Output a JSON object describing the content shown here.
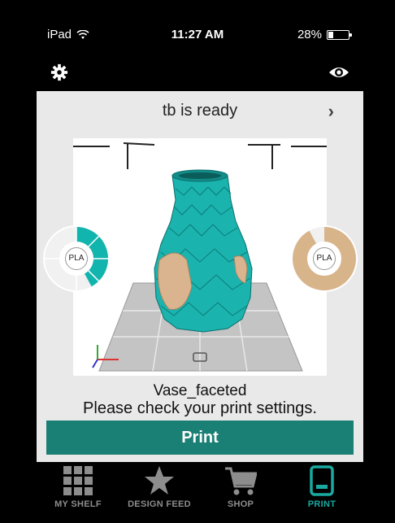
{
  "status_bar": {
    "device": "iPad",
    "time": "11:27 AM",
    "battery_text": "28%",
    "battery_level": 0.28
  },
  "toolbar": {
    "settings_icon": "gear-icon",
    "preview_icon": "eye-icon"
  },
  "card": {
    "status_title": "tb is ready",
    "chevron": "›",
    "model_name": "Vase_faceted",
    "message": "Please check your print settings.",
    "print_label": "Print",
    "left_filament": {
      "label": "PLA",
      "color": "#12b5ad",
      "level": 0.42
    },
    "right_filament": {
      "label": "PLA",
      "color": "#d8b48b",
      "level": 0.92
    },
    "model_color": "#1ab3ae",
    "model_accent": "#d9b48e"
  },
  "tabs": [
    {
      "label": "MY SHELF",
      "icon": "grid-icon",
      "active": false
    },
    {
      "label": "DESIGN FEED",
      "icon": "star-icon",
      "active": false
    },
    {
      "label": "SHOP",
      "icon": "cart-icon",
      "active": false
    },
    {
      "label": "PRINT",
      "icon": "printer-icon",
      "active": true
    }
  ],
  "colors": {
    "accent": "#1a7f74",
    "active_tab": "#1aa9a0",
    "inactive_tab": "#8d8d8d"
  }
}
